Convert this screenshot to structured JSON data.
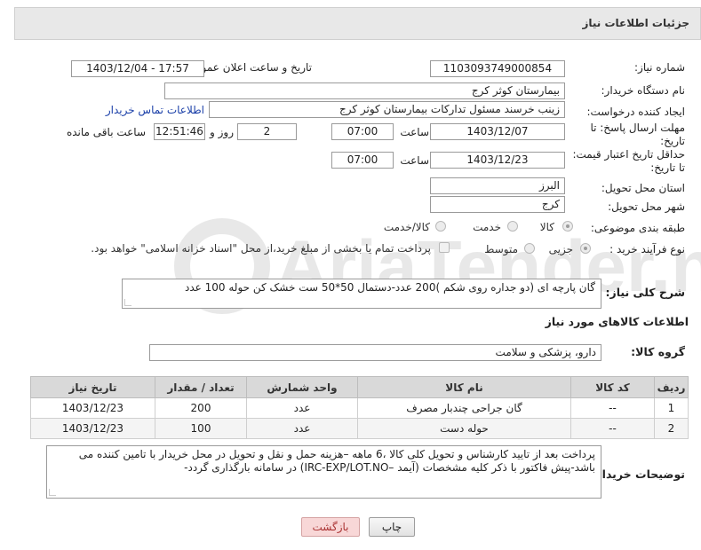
{
  "header": {
    "title": "جزئیات اطلاعات نیاز"
  },
  "fields": {
    "need_number_label": "شماره نیاز:",
    "need_number": "1103093749000854",
    "announce_label": "تاریخ و ساعت اعلان عمومی:",
    "announce_value": "1403/12/04 - 17:57",
    "buyer_org_label": "نام دستگاه خریدار:",
    "buyer_org": "بیمارستان کوثر کرج",
    "creator_label": "ایجاد کننده درخواست:",
    "creator": "زینب خرسند مسئول تدارکات بیمارستان کوثر کرج",
    "contact_link": "اطلاعات تماس خریدار",
    "deadline_label": "مهلت ارسال پاسخ: تا تاریخ:",
    "deadline_date": "1403/12/07",
    "time_label": "ساعت",
    "deadline_time": "07:00",
    "days_value": "2",
    "days_label": "روز و",
    "remaining_time": "12:51:46",
    "remaining_label": "ساعت باقی مانده",
    "validity_label": "حداقل تاریخ اعتبار قیمت: تا تاریخ:",
    "validity_date": "1403/12/23",
    "validity_time": "07:00",
    "province_label": "استان محل تحویل:",
    "province": "البرز",
    "city_label": "شهر محل تحویل:",
    "city": "کرج",
    "category_label": "طبقه بندی موضوعی:",
    "category_options": [
      "کالا",
      "خدمت",
      "کالا/خدمت"
    ],
    "process_label": "نوع فرآیند خرید :",
    "process_options": [
      "جزیی",
      "متوسط"
    ],
    "payment_note": "پرداخت تمام یا بخشی از مبلغ خرید،از محل \"اسناد خزانه اسلامی\" خواهد بود.",
    "description_label": "شرح کلی نیاز:",
    "description": "گان پارچه ای (دو جداره روی شکم  )200 عدد-دستمال 50*50 ست خشک کن حوله 100 عدد",
    "goods_info_title": "اطلاعات کالاهای مورد نیاز",
    "goods_group_label": "گروه کالا:",
    "goods_group": "دارو، پزشکی و سلامت",
    "buyer_notes_label": "توضیحات خریدار:",
    "buyer_notes": "پرداخت بعد از تایید کارشناس و تحویل کلی کالا ،6 ماهه –هزینه حمل و نقل و تحویل در محل خریدار با تامین کننده می باشد-پیش فاکتور با ذکر کلیه مشخصات (آیمد –IRC-EXP/LOT.NO) در سامانه بارگذاری گردد-"
  },
  "table": {
    "headers": [
      "ردیف",
      "کد کالا",
      "نام کالا",
      "واحد شمارش",
      "تعداد / مقدار",
      "تاریخ نیاز"
    ],
    "rows": [
      [
        "1",
        "--",
        "گان جراحی چندبار مصرف",
        "عدد",
        "200",
        "1403/12/23"
      ],
      [
        "2",
        "--",
        "حوله دست",
        "عدد",
        "100",
        "1403/12/23"
      ]
    ]
  },
  "buttons": {
    "print": "چاپ",
    "back": "بازگشت"
  },
  "watermark_text": "AriaTender.net",
  "colors": {
    "link": "#1a3fa8",
    "back_button": "#f8d7d7",
    "header_bg": "#e8e8e8"
  }
}
